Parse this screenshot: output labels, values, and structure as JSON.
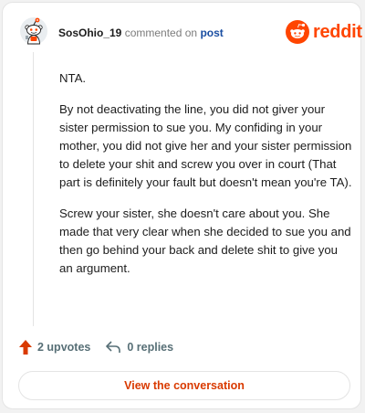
{
  "header": {
    "username": "SosOhio_19",
    "commented_on": "commented on",
    "post_link": "post",
    "logo_text": "reddit"
  },
  "comment": {
    "paragraphs": [
      "NTA.",
      "By not deactivating the line, you did not giver your sister permission to sue you. My confiding in your mother, you did not give her and your sister permission to delete your shit and screw you over in court (That part is definitely your fault but doesn't mean you're TA).",
      "Screw your sister, she doesn't care about you. She made that very clear when she decided to sue you and then go behind your back and delete shit to give you an argument."
    ]
  },
  "actions": {
    "upvotes": "2 upvotes",
    "replies": "0 replies"
  },
  "footer": {
    "view_button": "View the conversation"
  },
  "colors": {
    "brand": "#ff4500",
    "link": "#1a4ea2",
    "button_text": "#d93a00"
  },
  "icons": {
    "avatar": "snoo-avatar",
    "logo": "reddit-snoo-logo",
    "upvote": "upvote-arrow-icon",
    "reply": "reply-arrow-icon"
  }
}
